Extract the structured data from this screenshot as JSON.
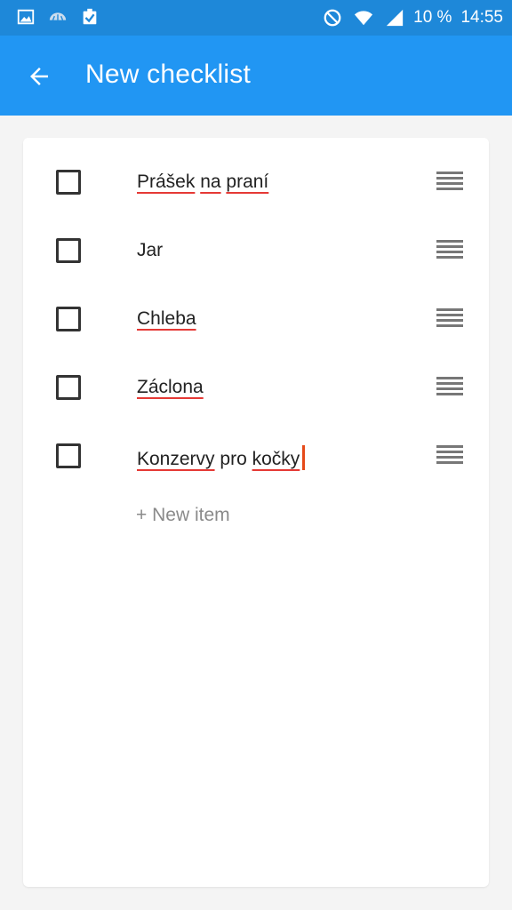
{
  "status_bar": {
    "battery": "10 %",
    "time": "14:55",
    "icons": [
      "gallery-icon",
      "weather-icon",
      "clipboard-check-icon",
      "do-not-disturb-icon",
      "wifi-icon",
      "signal-icon",
      "battery-icon"
    ]
  },
  "app_bar": {
    "back_icon": "arrow-back-icon",
    "title": "New checklist"
  },
  "checklist": {
    "items": [
      {
        "words": [
          "Prášek",
          "na",
          "praní"
        ],
        "checked": false
      },
      {
        "words": [
          "Jar"
        ],
        "checked": false
      },
      {
        "words": [
          "Chleba"
        ],
        "checked": false
      },
      {
        "words": [
          "Záclona"
        ],
        "checked": false
      },
      {
        "words": [
          "Konzervy",
          "pro",
          "kočky"
        ],
        "checked": false
      }
    ],
    "new_item_label": "+ New item"
  },
  "colors": {
    "status_bar": "#1e88d9",
    "app_bar": "#2196f3",
    "spellcheck_underline": "#e53935",
    "cursor": "#e64a19"
  }
}
